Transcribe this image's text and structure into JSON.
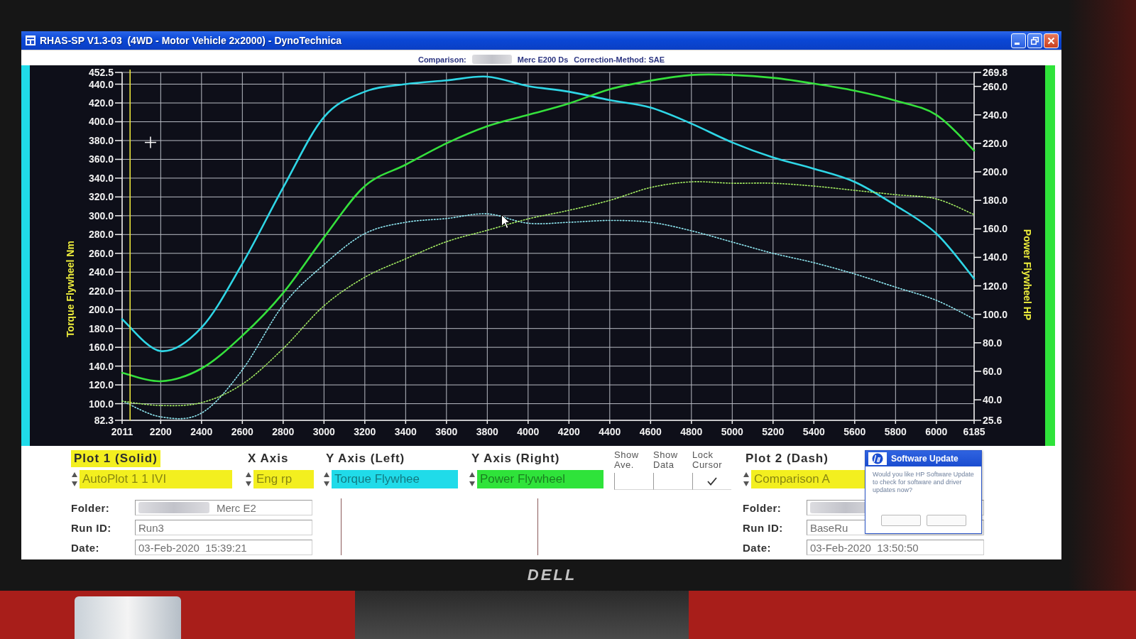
{
  "window": {
    "title": "RHAS-SP V1.3-03  (4WD - Motor Vehicle 2x2000) - DynoTechnica"
  },
  "chart_header": {
    "comparison_label": "Comparison:",
    "comparison_run": "Merc E200 Ds",
    "correction_method": "Correction-Method: SAE"
  },
  "chart": {
    "chart_data": {
      "type": "line",
      "ylabel": "Torque Flywheel Nm",
      "y2label": "Power Flywheel HP",
      "grid": true,
      "x": [
        2011,
        2200,
        2400,
        2600,
        2800,
        3000,
        3200,
        3400,
        3600,
        3800,
        4000,
        4200,
        4400,
        4600,
        4800,
        5000,
        5200,
        5400,
        5600,
        5800,
        6000,
        6185
      ],
      "xlim": [
        2011,
        6185
      ],
      "ylim": [
        82.3,
        452.5
      ],
      "y2lim": [
        25.6,
        269.8
      ],
      "xticks": [
        2011,
        2200,
        2400,
        2600,
        2800,
        3000,
        3200,
        3400,
        3600,
        3800,
        4000,
        4200,
        4400,
        4600,
        4800,
        5000,
        5200,
        5400,
        5600,
        5800,
        6000,
        6185
      ],
      "yticks": [
        {
          "value": 452.5,
          "label": "452.5"
        },
        {
          "value": 440,
          "label": "440.0"
        },
        {
          "value": 420,
          "label": "420.0"
        },
        {
          "value": 400,
          "label": "400.0"
        },
        {
          "value": 380,
          "label": "380.0"
        },
        {
          "value": 360,
          "label": "360.0"
        },
        {
          "value": 340,
          "label": "340.0"
        },
        {
          "value": 320,
          "label": "320.0"
        },
        {
          "value": 300,
          "label": "300.0"
        },
        {
          "value": 280,
          "label": "280.0"
        },
        {
          "value": 260,
          "label": "260.0"
        },
        {
          "value": 240,
          "label": "240.0"
        },
        {
          "value": 220,
          "label": "220.0"
        },
        {
          "value": 200,
          "label": "200.0"
        },
        {
          "value": 180,
          "label": "180.0"
        },
        {
          "value": 160,
          "label": "160.0"
        },
        {
          "value": 140,
          "label": "140.0"
        },
        {
          "value": 120,
          "label": "120.0"
        },
        {
          "value": 100,
          "label": "100.0"
        },
        {
          "value": 82.3,
          "label": "82.3"
        }
      ],
      "y2ticks": [
        {
          "value": 269.8,
          "label": "269.8"
        },
        {
          "value": 260,
          "label": "260.0"
        },
        {
          "value": 240,
          "label": "240.0"
        },
        {
          "value": 220,
          "label": "220.0"
        },
        {
          "value": 200,
          "label": "200.0"
        },
        {
          "value": 180,
          "label": "180.0"
        },
        {
          "value": 160,
          "label": "160.0"
        },
        {
          "value": 140,
          "label": "140.0"
        },
        {
          "value": 120,
          "label": "120.0"
        },
        {
          "value": 100,
          "label": "100.0"
        },
        {
          "value": 80,
          "label": "80.0"
        },
        {
          "value": 60,
          "label": "60.0"
        },
        {
          "value": 40,
          "label": "40.0"
        },
        {
          "value": 25.6,
          "label": "25.6"
        }
      ],
      "series": [
        {
          "color": "#2fd6e6",
          "values": [
            190,
            156,
            181,
            249,
            330,
            405,
            432,
            440,
            444,
            448,
            438,
            432,
            423,
            415,
            398,
            378,
            362,
            350,
            336,
            311,
            281,
            233
          ]
        },
        {
          "color": "#35e03c",
          "axis": "y2",
          "values": [
            59,
            53,
            62,
            85,
            115,
            154,
            190,
            205,
            220,
            232,
            240,
            248,
            258,
            264,
            268,
            268,
            266,
            262,
            257,
            250,
            240,
            215
          ]
        },
        {
          "color": "#8fe8f2",
          "line_style": "dotted",
          "values": [
            103,
            86,
            90,
            136,
            205,
            248,
            281,
            293,
            297,
            302,
            292,
            293,
            295,
            293,
            284,
            272,
            260,
            250,
            238,
            224,
            210,
            190
          ]
        },
        {
          "color": "#a4ec62",
          "axis": "y2",
          "line_style": "dotted",
          "values": [
            39,
            36,
            38,
            51,
            76,
            106,
            126,
            139,
            151,
            159,
            167,
            173,
            180,
            189,
            193,
            192,
            192,
            190,
            187,
            184,
            181,
            170
          ]
        }
      ],
      "ref_lines": [
        {
          "axis": "x",
          "value": 2050
        }
      ]
    }
  },
  "plots": [
    {
      "heading": "Plot 1 (Solid)",
      "selected": true,
      "source": "AutoPlot 1 1 IVI",
      "folder_label": "Folder:",
      "folder": "Merc E2",
      "run_id_label": "Run ID:",
      "run_id": "Run3",
      "date_label": "Date:",
      "date": "03-Feb-2020  15:39:21"
    },
    {
      "heading": "Plot 2 (Dash)",
      "selected": false,
      "source": "Comparison A",
      "folder_label": "Folder:",
      "run_id_label": "Run ID:",
      "run_id": "BaseRu",
      "date_label": "Date:",
      "date": "03-Feb-2020  13:50:50"
    }
  ],
  "axes": [
    {
      "kind": "x",
      "heading": "X Axis",
      "value": "Eng rp",
      "color": "#f3ef1f"
    },
    {
      "kind": "left",
      "heading": "Y Axis (Left)",
      "value": "Torque Flywhee",
      "color": "#20dbe9"
    },
    {
      "kind": "right",
      "heading": "Y Axis (Right)",
      "value": "Power Flywheel",
      "color": "#2fe33a"
    }
  ],
  "options": [
    {
      "label": "Show Ave.",
      "checked": false
    },
    {
      "label": "Show Data",
      "checked": false
    },
    {
      "label": "Lock Cursor",
      "checked": true
    }
  ],
  "software_update": {
    "title": "Software Update",
    "message": "Would you like HP Software Update to check for software and driver updates now?"
  },
  "monitor": {
    "logo": "DELL"
  }
}
